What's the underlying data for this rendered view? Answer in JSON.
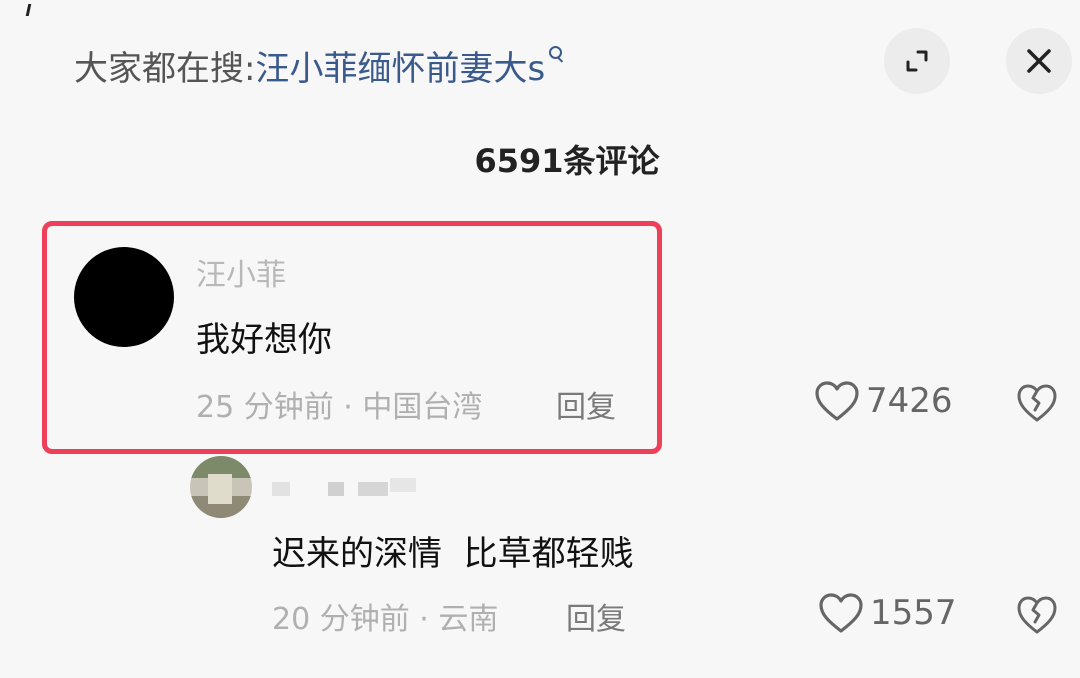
{
  "header": {
    "search_prefix": "大家都在搜:",
    "search_term": "汪小菲缅怀前妻大s",
    "search_icon": "search-icon",
    "expand_icon": "collapse-icon",
    "close_icon": "close-icon"
  },
  "comment_count": "6591条评论",
  "comments": [
    {
      "author": "汪小菲",
      "text": "我好想你",
      "meta": "25 分钟前 · 中国台湾",
      "reply_label": "回复",
      "likes": "7426",
      "highlight_color": "#ee4058"
    },
    {
      "text": "迟来的深情  比草都轻贱",
      "meta": "20 分钟前 · 云南",
      "reply_label": "回复",
      "likes": "1557"
    }
  ],
  "colors": {
    "link": "#3a5a8c",
    "highlight": "#ee4058"
  }
}
